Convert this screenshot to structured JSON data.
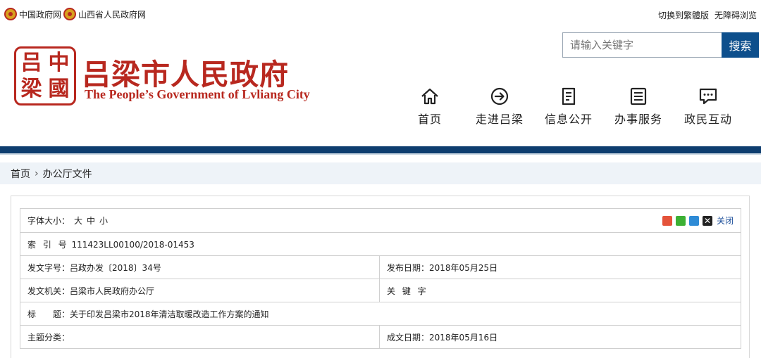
{
  "topbar": {
    "links": [
      "中国政府网",
      "山西省人民政府网"
    ],
    "right": [
      "切换到繁體版",
      "无障碍浏览"
    ]
  },
  "header": {
    "seal_chars": [
      "吕",
      "中",
      "梁",
      "國"
    ],
    "title": "吕梁市人民政府",
    "subtitle": "The People’s Government of Lvliang City",
    "search": {
      "placeholder": "请输入关键字",
      "button": "搜索"
    },
    "nav": [
      {
        "label": "首页",
        "icon": "home-icon"
      },
      {
        "label": "走进吕梁",
        "icon": "arrow-circle-icon"
      },
      {
        "label": "信息公开",
        "icon": "document-icon"
      },
      {
        "label": "办事服务",
        "icon": "list-icon"
      },
      {
        "label": "政民互动",
        "icon": "chat-icon"
      }
    ]
  },
  "breadcrumb": {
    "home": "首页",
    "current": "办公厅文件"
  },
  "doc": {
    "font_size_label": "字体大小：",
    "font_sizes": [
      "大",
      "中",
      "小"
    ],
    "close": "关闭",
    "index_label": "索 引 号",
    "index_value": "111423LL00100/2018-01453",
    "doc_no_label": "发文字号：",
    "doc_no_value": "吕政办发〔2018〕34号",
    "publish_date_label": "发布日期：",
    "publish_date_value": "2018年05月25日",
    "issuer_label": "发文机关：",
    "issuer_value": "吕梁市人民政府办公厅",
    "keyword_label": "关 键 字",
    "title_label": "标　　题：",
    "title_value": "关于印发吕梁市2018年清洁取暖改造工作方案的通知",
    "category_label": "主题分类：",
    "made_date_label": "成文日期：",
    "made_date_value": "2018年05月16日"
  },
  "colors": {
    "brand_red": "#b8281f",
    "nav_blue": "#0e3d6f",
    "search_blue": "#0d4f8c"
  }
}
